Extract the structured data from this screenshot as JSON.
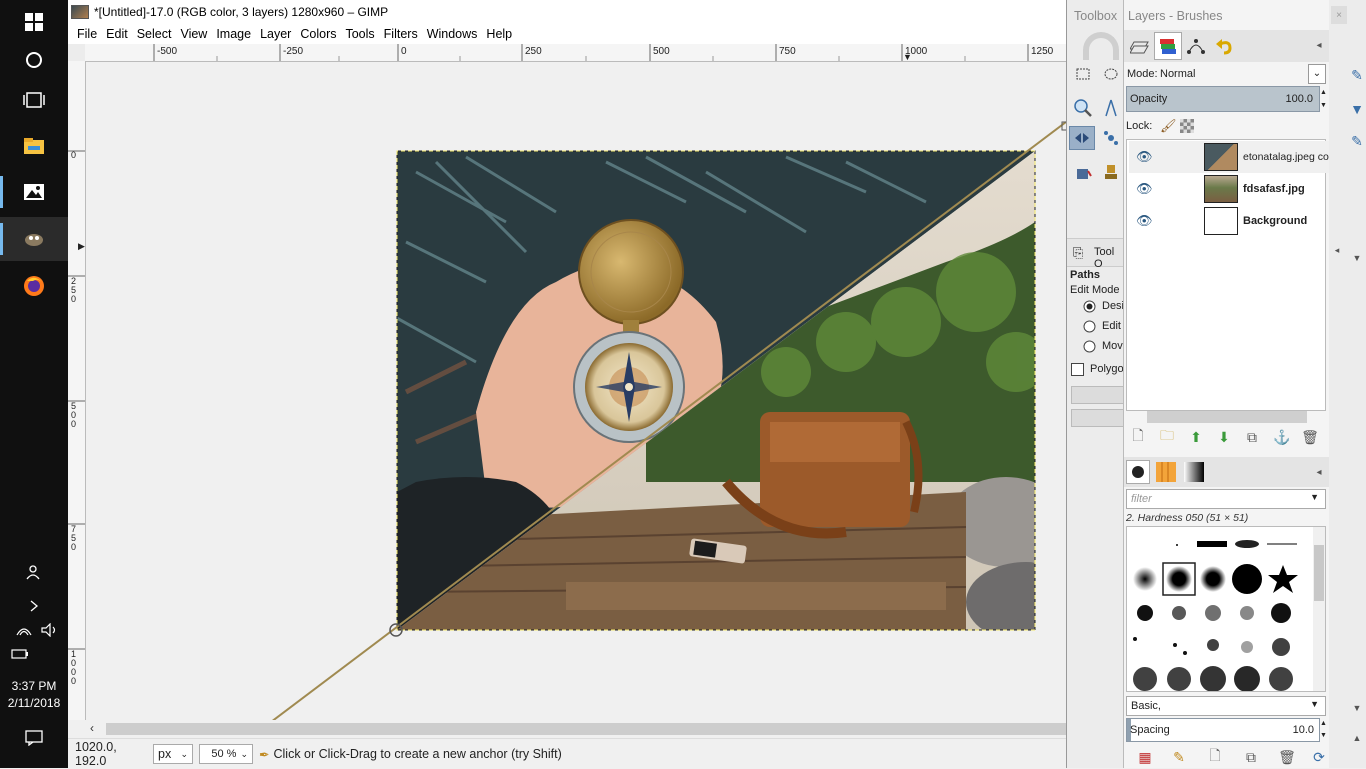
{
  "taskbar": {
    "time": "3:37 PM",
    "date": "2/11/2018",
    "icons": [
      "windows-start-icon",
      "cortana-icon",
      "task-view-icon",
      "file-explorer-icon",
      "photos-icon",
      "gimp-icon",
      "firefox-icon"
    ]
  },
  "window": {
    "title": "*[Untitled]-17.0 (RGB color, 3 layers) 1280x960 – GIMP"
  },
  "menu": [
    "File",
    "Edit",
    "Select",
    "View",
    "Image",
    "Layer",
    "Colors",
    "Tools",
    "Filters",
    "Windows",
    "Help"
  ],
  "ruler": {
    "h_labels": [
      "-500",
      "-250",
      "0",
      "250",
      "500",
      "750",
      "1000",
      "1250"
    ],
    "v_labels": [
      "0",
      "250",
      "500",
      "750",
      "1000"
    ]
  },
  "status": {
    "coords": "1020.0, 192.0",
    "unit": "px",
    "zoom": "50 %",
    "hint": "Click or Click-Drag to create a new anchor (try Shift)"
  },
  "toolbox": {
    "title": "Toolbox",
    "tool_options_title": "Tool O",
    "paths_label": "Paths",
    "edit_mode_label": "Edit Mode",
    "modes": [
      "Desi",
      "Edit",
      "Mov"
    ],
    "selected_mode": 0,
    "polygonal_label": "Polygo"
  },
  "layers": {
    "title": "Layers - Brushes",
    "mode_label": "Mode:",
    "mode_value": "Normal",
    "opacity_label": "Opacity",
    "opacity_value": "100.0",
    "lock_label": "Lock:",
    "items": [
      {
        "name": "etonatalag.jpeg cop",
        "bold": false
      },
      {
        "name": "fdsafasf.jpg",
        "bold": true
      },
      {
        "name": "Background",
        "bold": true
      }
    ]
  },
  "brushes": {
    "filter_placeholder": "filter",
    "selected_brush": "2. Hardness 050 (51 × 51)",
    "preset": "Basic,",
    "spacing_label": "Spacing",
    "spacing_value": "10.0"
  },
  "colors": {
    "taskbar_bg": "#101010",
    "accent": "#76b9ed",
    "selection": "#9ab0c8",
    "path_line": "#a08a50"
  }
}
